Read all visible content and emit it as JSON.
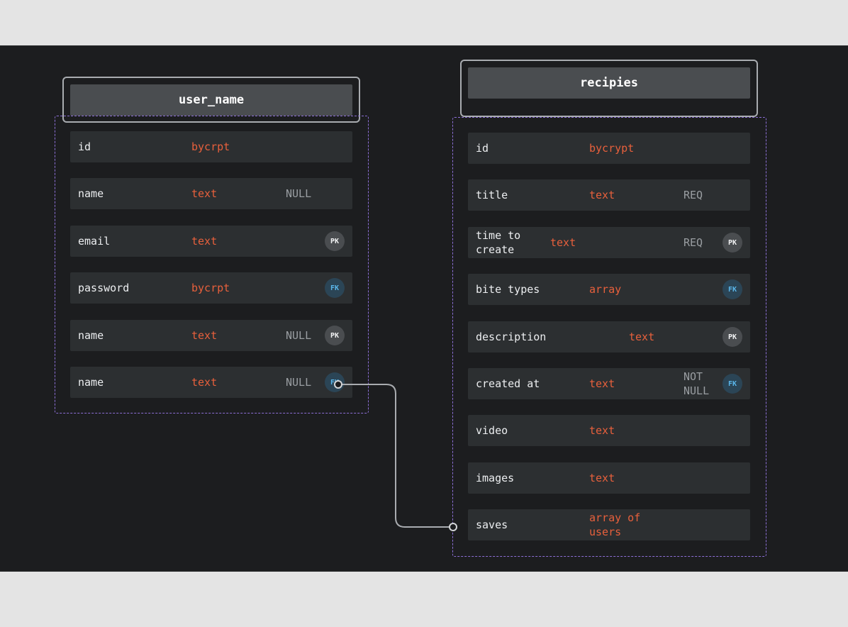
{
  "tables": [
    {
      "title": "user_name",
      "rows": [
        {
          "name": "id",
          "type": "bycrpt",
          "constraint": "",
          "key": ""
        },
        {
          "name": "name",
          "type": "text",
          "constraint": "NULL",
          "key": ""
        },
        {
          "name": "email",
          "type": "text",
          "constraint": "",
          "key": "PK"
        },
        {
          "name": "password",
          "type": "bycrpt",
          "constraint": "",
          "key": "FK"
        },
        {
          "name": "name",
          "type": "text",
          "constraint": "NULL",
          "key": "PK"
        },
        {
          "name": "name",
          "type": "text",
          "constraint": "NULL",
          "key": "FK"
        }
      ]
    },
    {
      "title": "recipies",
      "rows": [
        {
          "name": "id",
          "type": "bycrypt",
          "constraint": "",
          "key": ""
        },
        {
          "name": "title",
          "type": "text",
          "constraint": "REQ",
          "key": ""
        },
        {
          "name": "time to create",
          "type": "text",
          "constraint": "REQ",
          "key": "PK"
        },
        {
          "name": "bite types",
          "type": "array",
          "constraint": "",
          "key": "FK"
        },
        {
          "name": "description",
          "type": "text",
          "constraint": "",
          "key": "PK"
        },
        {
          "name": "created at",
          "type": "text",
          "constraint": "NOT NULL",
          "key": "FK"
        },
        {
          "name": "video",
          "type": "text",
          "constraint": "",
          "key": ""
        },
        {
          "name": "images",
          "type": "text",
          "constraint": "",
          "key": ""
        },
        {
          "name": "saves",
          "type": "array of users",
          "constraint": "",
          "key": ""
        }
      ]
    }
  ],
  "relationships": [
    {
      "from": "user_name.name",
      "to": "recipies.saves"
    }
  ],
  "colors": {
    "canvas": "#1c1d1f",
    "row": "#2c2f31",
    "header": "#4a4d50",
    "type_text": "#e8603c",
    "group_border": "#8c6fd6",
    "fk_badge": "#5ab6ea"
  }
}
